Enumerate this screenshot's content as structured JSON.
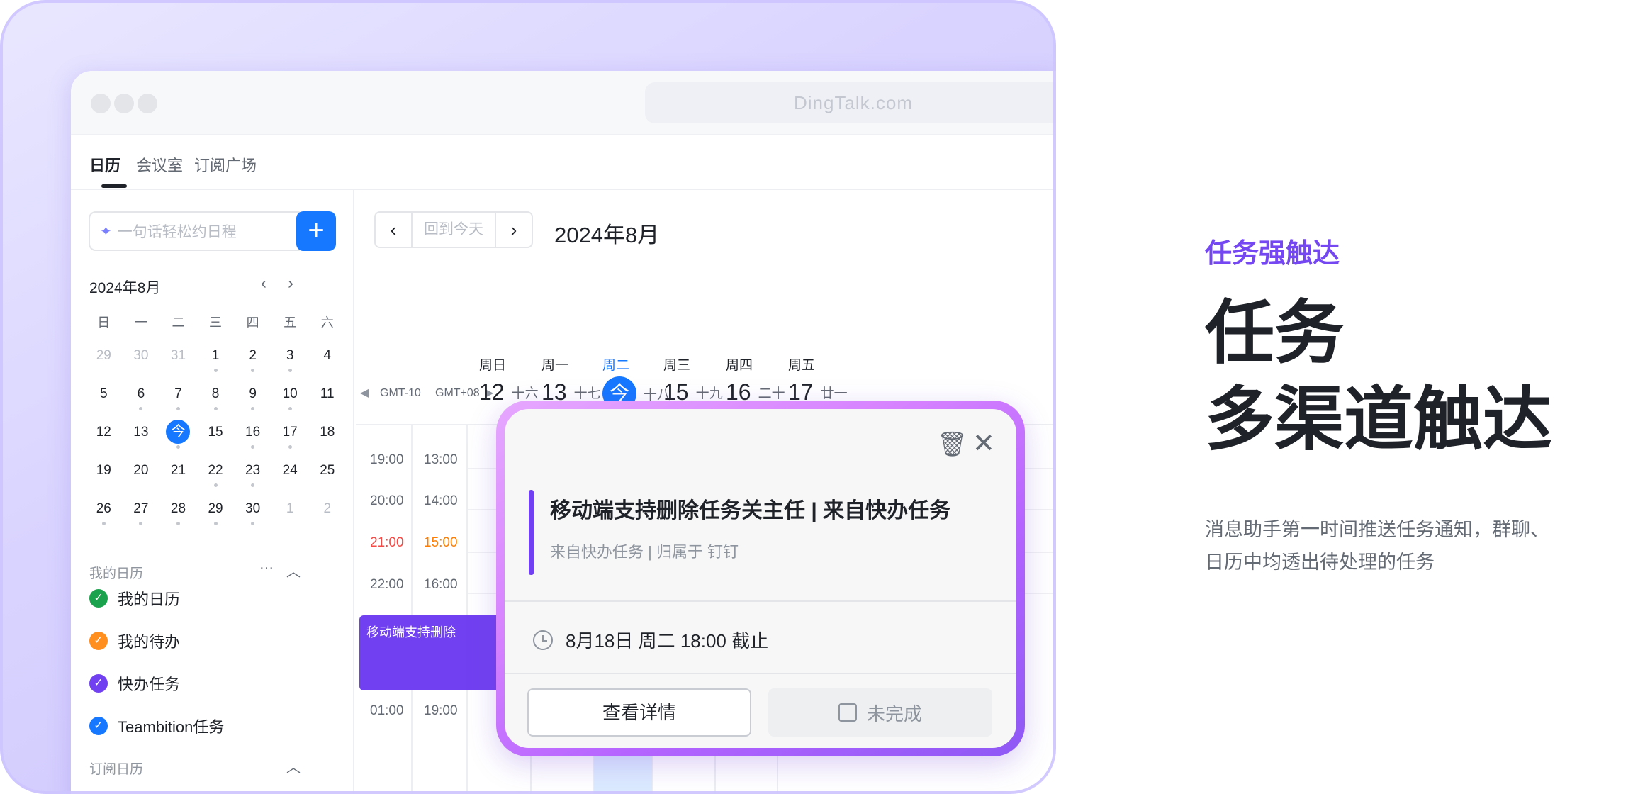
{
  "window": {
    "url": "DingTalk.com"
  },
  "topnav": {
    "tabs": [
      "日历",
      "会议室",
      "订阅广场"
    ]
  },
  "sidebar": {
    "search_placeholder": "一句话轻松约日程",
    "add_label": "+",
    "month_title": "2024年8月",
    "weekday_heads": [
      "日",
      "一",
      "二",
      "三",
      "四",
      "五",
      "六"
    ],
    "weeks": [
      [
        "29",
        "30",
        "31",
        "1",
        "2",
        "3",
        "4"
      ],
      [
        "5",
        "6",
        "7",
        "8",
        "9",
        "10",
        "11"
      ],
      [
        "12",
        "13",
        "今",
        "15",
        "16",
        "17",
        "18"
      ],
      [
        "19",
        "20",
        "21",
        "22",
        "23",
        "24",
        "25"
      ],
      [
        "26",
        "27",
        "28",
        "29",
        "30",
        "1",
        "2"
      ]
    ],
    "my_calendars_label": "我的日历",
    "calendars": [
      {
        "label": "我的日历",
        "color": "#1aa24c"
      },
      {
        "label": "我的待办",
        "color": "#ff8f1f"
      },
      {
        "label": "快办任务",
        "color": "#7140f0"
      },
      {
        "label": "Teambition任务",
        "color": "#1677ff"
      }
    ],
    "subscribed_label": "订阅日历"
  },
  "main": {
    "today_button": "回到今天",
    "title": "2024年8月",
    "view": "周",
    "tz_left": "GMT-10",
    "tz_right": "GMT+08",
    "days": [
      {
        "weekday": "周日",
        "num": "12",
        "lunar": "十六"
      },
      {
        "weekday": "周一",
        "num": "13",
        "lunar": "十七"
      },
      {
        "weekday": "周二",
        "num": "今",
        "lunar": "十八"
      },
      {
        "weekday": "周三",
        "num": "15",
        "lunar": "十九"
      },
      {
        "weekday": "周四",
        "num": "16",
        "lunar": "二十"
      },
      {
        "weekday": "周五",
        "num": "17",
        "lunar": "廿一"
      }
    ],
    "times_left": [
      "19:00",
      "20:00",
      "21:00",
      "22:00",
      "01:00"
    ],
    "times_right": [
      "13:00",
      "14:00",
      "15:00",
      "16:00",
      "19:00"
    ],
    "event_label": "移动端支持删除"
  },
  "popup": {
    "title": "移动端支持删除任务关主任 | 来自快办任务",
    "subtitle": "来自快办任务 | 归属于 钉钉",
    "when": "8月18日 周二 18:00 截止",
    "detail_button": "查看详情",
    "done_label": "未完成"
  },
  "copy": {
    "tag": "任务强触达",
    "heading_line1": "任务",
    "heading_line2": "多渠道触达",
    "paragraph": "消息助手第一时间推送任务通知，群聊、日历中均透出待处理的任务"
  }
}
